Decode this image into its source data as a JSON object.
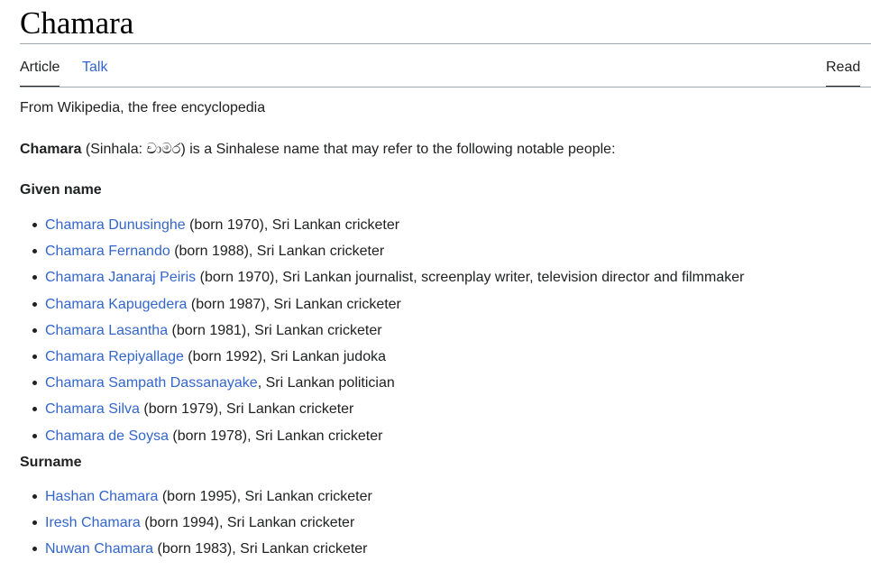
{
  "article": {
    "title": "Chamara"
  },
  "tabs": {
    "article": "Article",
    "talk": "Talk",
    "read": "Read"
  },
  "tagline": "From Wikipedia, the free encyclopedia",
  "intro": {
    "bold": "Chamara",
    "text": " (Sinhala: චාමර) is a Sinhalese name that may refer to the following notable people:"
  },
  "given_name": {
    "heading": "Given name",
    "items": [
      {
        "link": "Chamara Dunusinghe",
        "desc": " (born 1970), Sri Lankan cricketer"
      },
      {
        "link": "Chamara Fernando",
        "desc": " (born 1988), Sri Lankan cricketer"
      },
      {
        "link": "Chamara Janaraj Peiris",
        "desc": " (born 1970), Sri Lankan journalist, screenplay writer, television director and filmmaker"
      },
      {
        "link": "Chamara Kapugedera",
        "desc": " (born 1987), Sri Lankan cricketer"
      },
      {
        "link": "Chamara Lasantha",
        "desc": " (born 1981), Sri Lankan cricketer"
      },
      {
        "link": "Chamara Repiyallage",
        "desc": " (born 1992), Sri Lankan judoka"
      },
      {
        "link": "Chamara Sampath Dassanayake",
        "desc": ", Sri Lankan politician"
      },
      {
        "link": "Chamara Silva",
        "desc": " (born 1979), Sri Lankan cricketer"
      },
      {
        "link": "Chamara de Soysa",
        "desc": " (born 1978), Sri Lankan cricketer"
      }
    ]
  },
  "surname": {
    "heading": "Surname",
    "items": [
      {
        "link": "Hashan Chamara",
        "desc": " (born 1995), Sri Lankan cricketer"
      },
      {
        "link": "Iresh Chamara",
        "desc": " (born 1994), Sri Lankan cricketer"
      },
      {
        "link": "Nuwan Chamara",
        "desc": " (born 1983), Sri Lankan cricketer"
      }
    ]
  },
  "colors": {
    "link": "#3366cc",
    "text": "#202122",
    "rule": "#a2a9b1"
  }
}
